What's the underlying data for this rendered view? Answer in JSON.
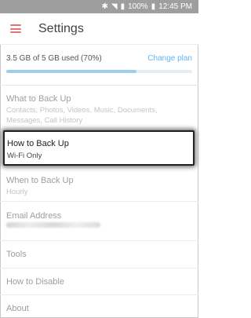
{
  "status_bar": {
    "battery": "100%",
    "time": "12:45 PM",
    "icons": [
      "bluetooth-icon",
      "wifi-icon",
      "signal-icon",
      "battery-icon"
    ]
  },
  "app_bar": {
    "title": "Settings",
    "menu_icon": "hamburger-menu-icon"
  },
  "storage": {
    "used_text": "3.5 GB of 5 GB used (70%)",
    "used_fraction": 0.7,
    "change_plan_label": "Change plan"
  },
  "settings": {
    "what_to_back_up": {
      "label": "What to Back Up",
      "detail": "Contacts, Photos, Videos, Music, Documents, Messages, Call History"
    },
    "how_to_back_up": {
      "label": "How to Back Up",
      "detail": "Wi-Fi Only"
    },
    "when_to_back_up": {
      "label": "When to Back Up",
      "detail": "Hourly"
    },
    "email_address": {
      "label": "Email Address"
    },
    "tools": {
      "label": "Tools"
    },
    "how_to_disable": {
      "label": "How to Disable"
    },
    "about": {
      "label": "About"
    }
  },
  "colors": {
    "accent": "#e57373",
    "link": "#64b5f6",
    "progress": "#9bd0ec",
    "status_bar": "#9e9e9e"
  }
}
